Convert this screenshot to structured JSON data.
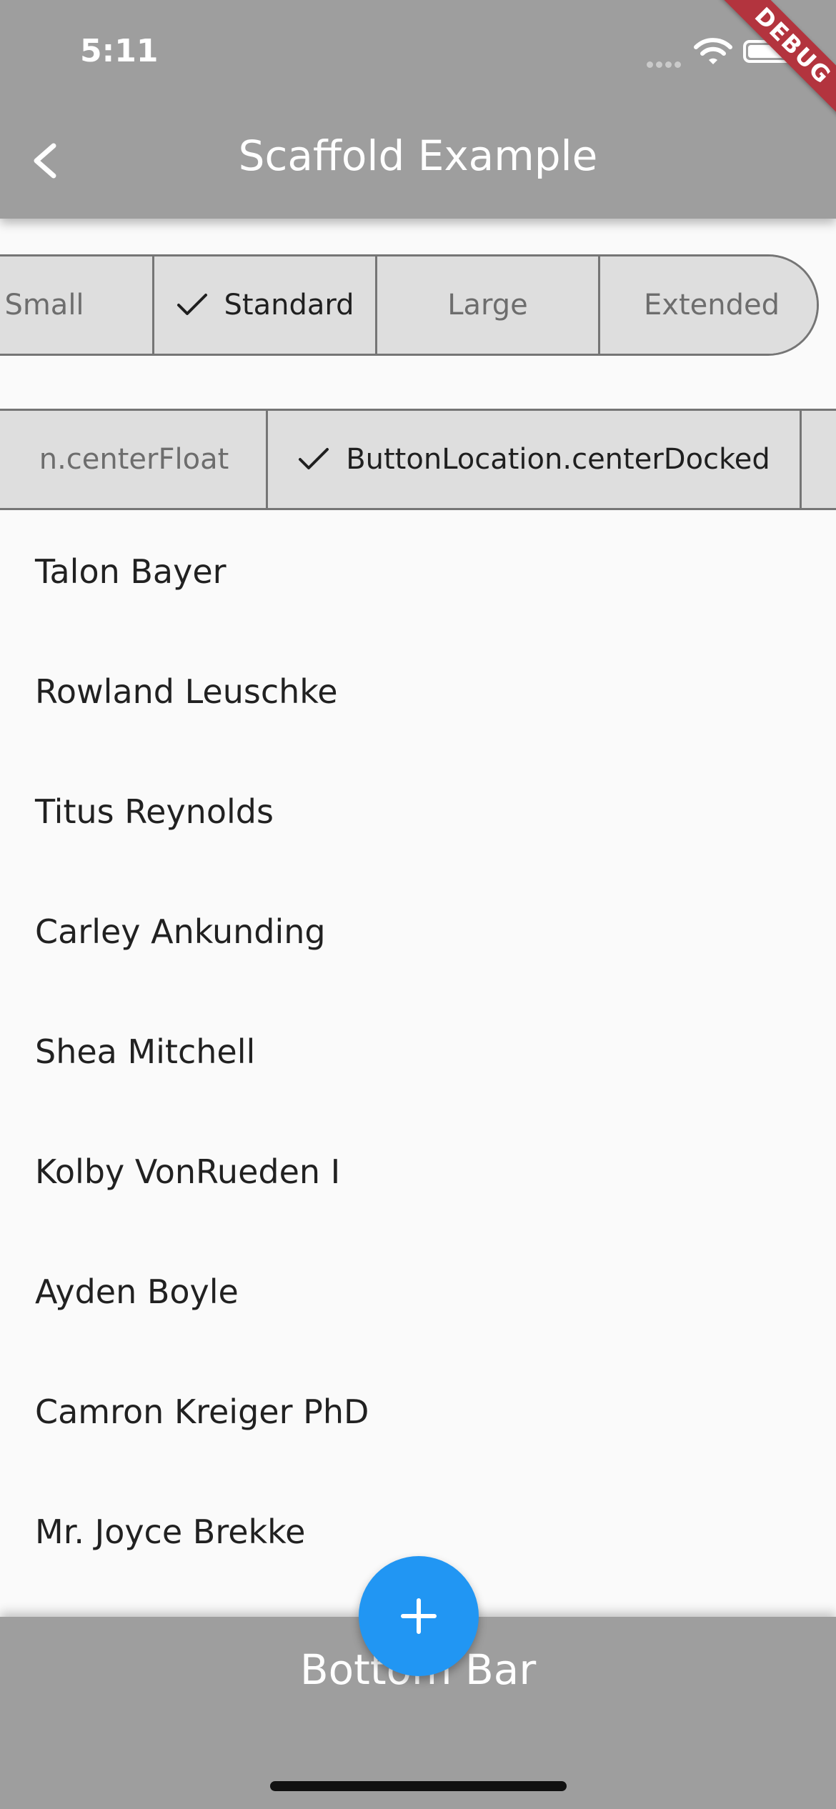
{
  "status_bar": {
    "time": "5:11",
    "icons": [
      "signal-icon",
      "wifi-icon",
      "battery-icon"
    ]
  },
  "debug_banner": "DEBUG",
  "app_bar": {
    "title": "Scaffold Example",
    "back_icon": "chevron-left-icon"
  },
  "fab_size_selector": {
    "segments": [
      {
        "label": "Small",
        "selected": false
      },
      {
        "label": "Standard",
        "selected": true
      },
      {
        "label": "Large",
        "selected": false
      },
      {
        "label": "Extended",
        "selected": false
      }
    ]
  },
  "fab_location_selector": {
    "segments": [
      {
        "label": "n.centerFloat",
        "selected": false
      },
      {
        "label": "ButtonLocation.centerDocked",
        "selected": true
      },
      {
        "label": "",
        "selected": false
      }
    ]
  },
  "list": {
    "items": [
      "Talon Bayer",
      "Rowland Leuschke",
      "Titus Reynolds",
      "Carley Ankunding",
      "Shea Mitchell",
      "Kolby VonRueden I",
      "Ayden Boyle",
      "Camron Kreiger PhD",
      "Mr. Joyce Brekke"
    ]
  },
  "bottom_bar": {
    "label": "Bottom Bar"
  },
  "fab": {
    "icon": "plus-icon"
  },
  "colors": {
    "app_bar": "#9e9e9e",
    "fab": "#2196f3",
    "segment_bg": "#dedede",
    "debug_ribbon": "#b3343e"
  }
}
